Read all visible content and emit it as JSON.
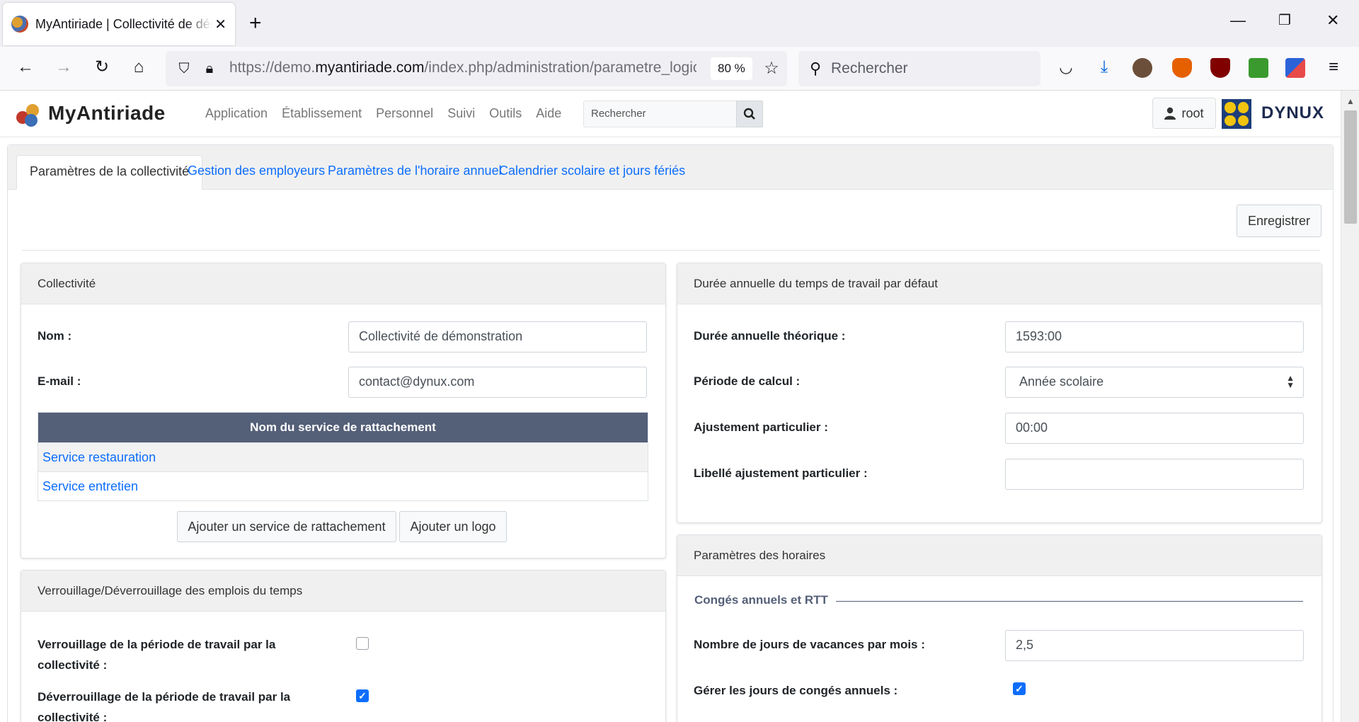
{
  "browser": {
    "tab_title": "MyAntiriade | Collectivité de démonstration",
    "url_prefix": "https://demo.",
    "url_domain": "myantiriade.com",
    "url_path": "/index.php/administration/parametre_logiciel",
    "zoom": "80 %",
    "search_placeholder": "Rechercher"
  },
  "app": {
    "logo_text": "MyAntiriade",
    "menu": [
      "Application",
      "Établissement",
      "Personnel",
      "Suivi",
      "Outils",
      "Aide"
    ],
    "search_placeholder": "Rechercher",
    "user": "root",
    "brand": "DYNUX"
  },
  "tabs": [
    "Paramètres de la collectivité",
    "Gestion des employeurs",
    "Paramètres de l'horaire annuel",
    "Calendrier scolaire et jours fériés"
  ],
  "save_label": "Enregistrer",
  "collectivite": {
    "title": "Collectivité",
    "nom_label": "Nom :",
    "nom_value": "Collectivité de démonstration",
    "email_label": "E-mail :",
    "email_value": "contact@dynux.com",
    "table_header": "Nom du service de rattachement",
    "services": [
      "Service restauration",
      "Service entretien"
    ],
    "btn_add_service": "Ajouter un service de rattachement",
    "btn_add_logo": "Ajouter un logo"
  },
  "verrouillage": {
    "title": "Verrouillage/Déverrouillage des emplois du temps",
    "lock_label_1": "Verrouillage de la période de travail par la",
    "lock_label_2": "collectivité :",
    "lock_checked": false,
    "unlock_label_1": "Déverrouillage de la période de travail par la",
    "unlock_label_2": "collectivité :",
    "unlock_checked": true
  },
  "duree": {
    "title": "Durée annuelle du temps de travail par défaut",
    "theorique_label": "Durée annuelle théorique :",
    "theorique_value": "1593:00",
    "periode_label": "Période de calcul :",
    "periode_value": "Année scolaire",
    "ajustement_label": "Ajustement particulier :",
    "ajustement_value": "00:00",
    "libelle_label": "Libellé ajustement particulier :",
    "libelle_value": ""
  },
  "horaires": {
    "title": "Paramètres des horaires",
    "section": "Congés annuels et RTT",
    "jours_label": "Nombre de jours de vacances par mois :",
    "jours_value": "2,5",
    "gerer_label": "Gérer les jours de congés annuels :",
    "gerer_checked": true
  }
}
